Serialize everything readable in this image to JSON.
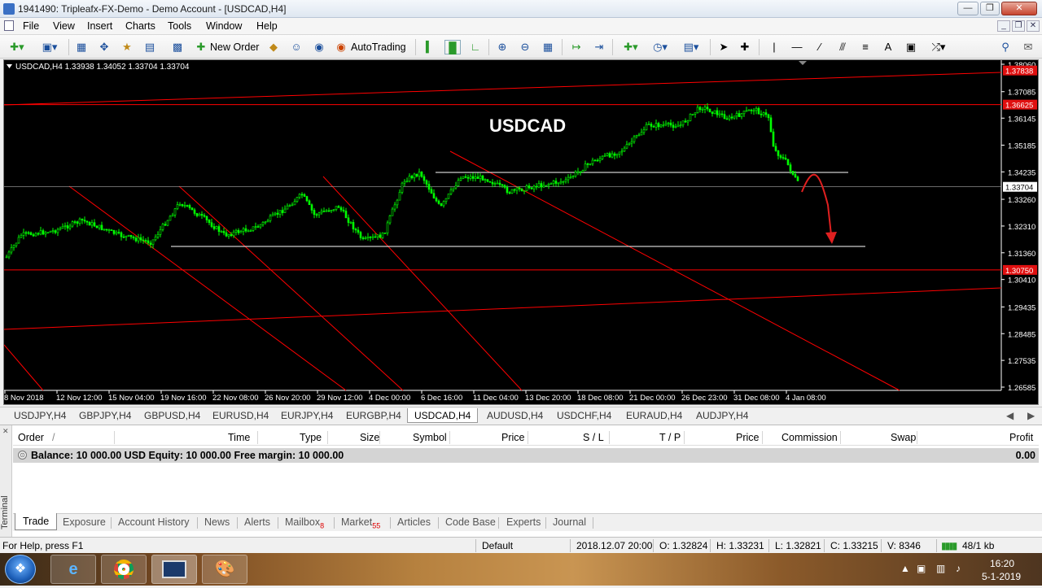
{
  "window": {
    "title": "1941490: Tripleafx-FX-Demo - Demo Account - [USDCAD,H4]"
  },
  "menu": [
    "File",
    "View",
    "Insert",
    "Charts",
    "Tools",
    "Window",
    "Help"
  ],
  "toolbar": {
    "new_order": "New Order",
    "auto_trading": "AutoTrading"
  },
  "chart": {
    "header": "USDCAD,H4  1.33938 1.34052 1.33704 1.33704",
    "watermark": "USDCAD",
    "current_price": "1.33704",
    "price_labels": [
      "1.38060",
      "1.37085",
      "1.36145",
      "1.35185",
      "1.34235",
      "1.33260",
      "1.32310",
      "1.31360",
      "1.30410",
      "1.29435",
      "1.28485",
      "1.27535",
      "1.26585"
    ],
    "level_labels": [
      "1.37838",
      "1.36625",
      "1.30750"
    ],
    "date_labels": [
      "8 Nov 2018",
      "12 Nov 12:00",
      "15 Nov 04:00",
      "19 Nov 16:00",
      "22 Nov 08:00",
      "26 Nov 20:00",
      "29 Nov 12:00",
      "4 Dec 00:00",
      "6 Dec 16:00",
      "11 Dec 04:00",
      "13 Dec 20:00",
      "18 Dec 08:00",
      "21 Dec 00:00",
      "26 Dec 23:00",
      "31 Dec 08:00",
      "4 Jan 08:00"
    ],
    "colors": {
      "background": "#000000",
      "candles": "#00ff00",
      "trendlines": "#ff0000",
      "levels": "#ffffff"
    }
  },
  "symbol_tabs": [
    "USDJPY,H4",
    "GBPJPY,H4",
    "GBPUSD,H4",
    "EURUSD,H4",
    "EURJPY,H4",
    "EURGBP,H4",
    "USDCAD,H4",
    "AUDUSD,H4",
    "USDCHF,H4",
    "EURAUD,H4",
    "AUDJPY,H4"
  ],
  "active_symbol_tab": "USDCAD,H4",
  "terminal": {
    "side_label": "Terminal",
    "columns": [
      "Order",
      "/",
      "Time",
      "Type",
      "Size",
      "Symbol",
      "Price",
      "S / L",
      "T / P",
      "Price",
      "Commission",
      "Swap",
      "Profit"
    ],
    "balance_text": "Balance: 10 000.00 USD  Equity: 10 000.00  Free margin: 10 000.00",
    "balance_profit": "0.00",
    "tabs": [
      {
        "label": "Trade"
      },
      {
        "label": "Exposure"
      },
      {
        "label": "Account History"
      },
      {
        "label": "News"
      },
      {
        "label": "Alerts"
      },
      {
        "label": "Mailbox",
        "badge": "8"
      },
      {
        "label": "Market",
        "badge": "55"
      },
      {
        "label": "Articles"
      },
      {
        "label": "Code Base"
      },
      {
        "label": "Experts"
      },
      {
        "label": "Journal"
      }
    ]
  },
  "status": {
    "help": "For Help, press F1",
    "profile": "Default",
    "datetime": "2018.12.07 20:00",
    "open": "O: 1.32824",
    "high": "H: 1.33231",
    "low": "L: 1.32821",
    "close": "C: 1.33215",
    "volume": "V: 8346",
    "traffic": "48/1 kb"
  },
  "taskbar": {
    "time": "16:20",
    "date": "5-1-2019"
  }
}
